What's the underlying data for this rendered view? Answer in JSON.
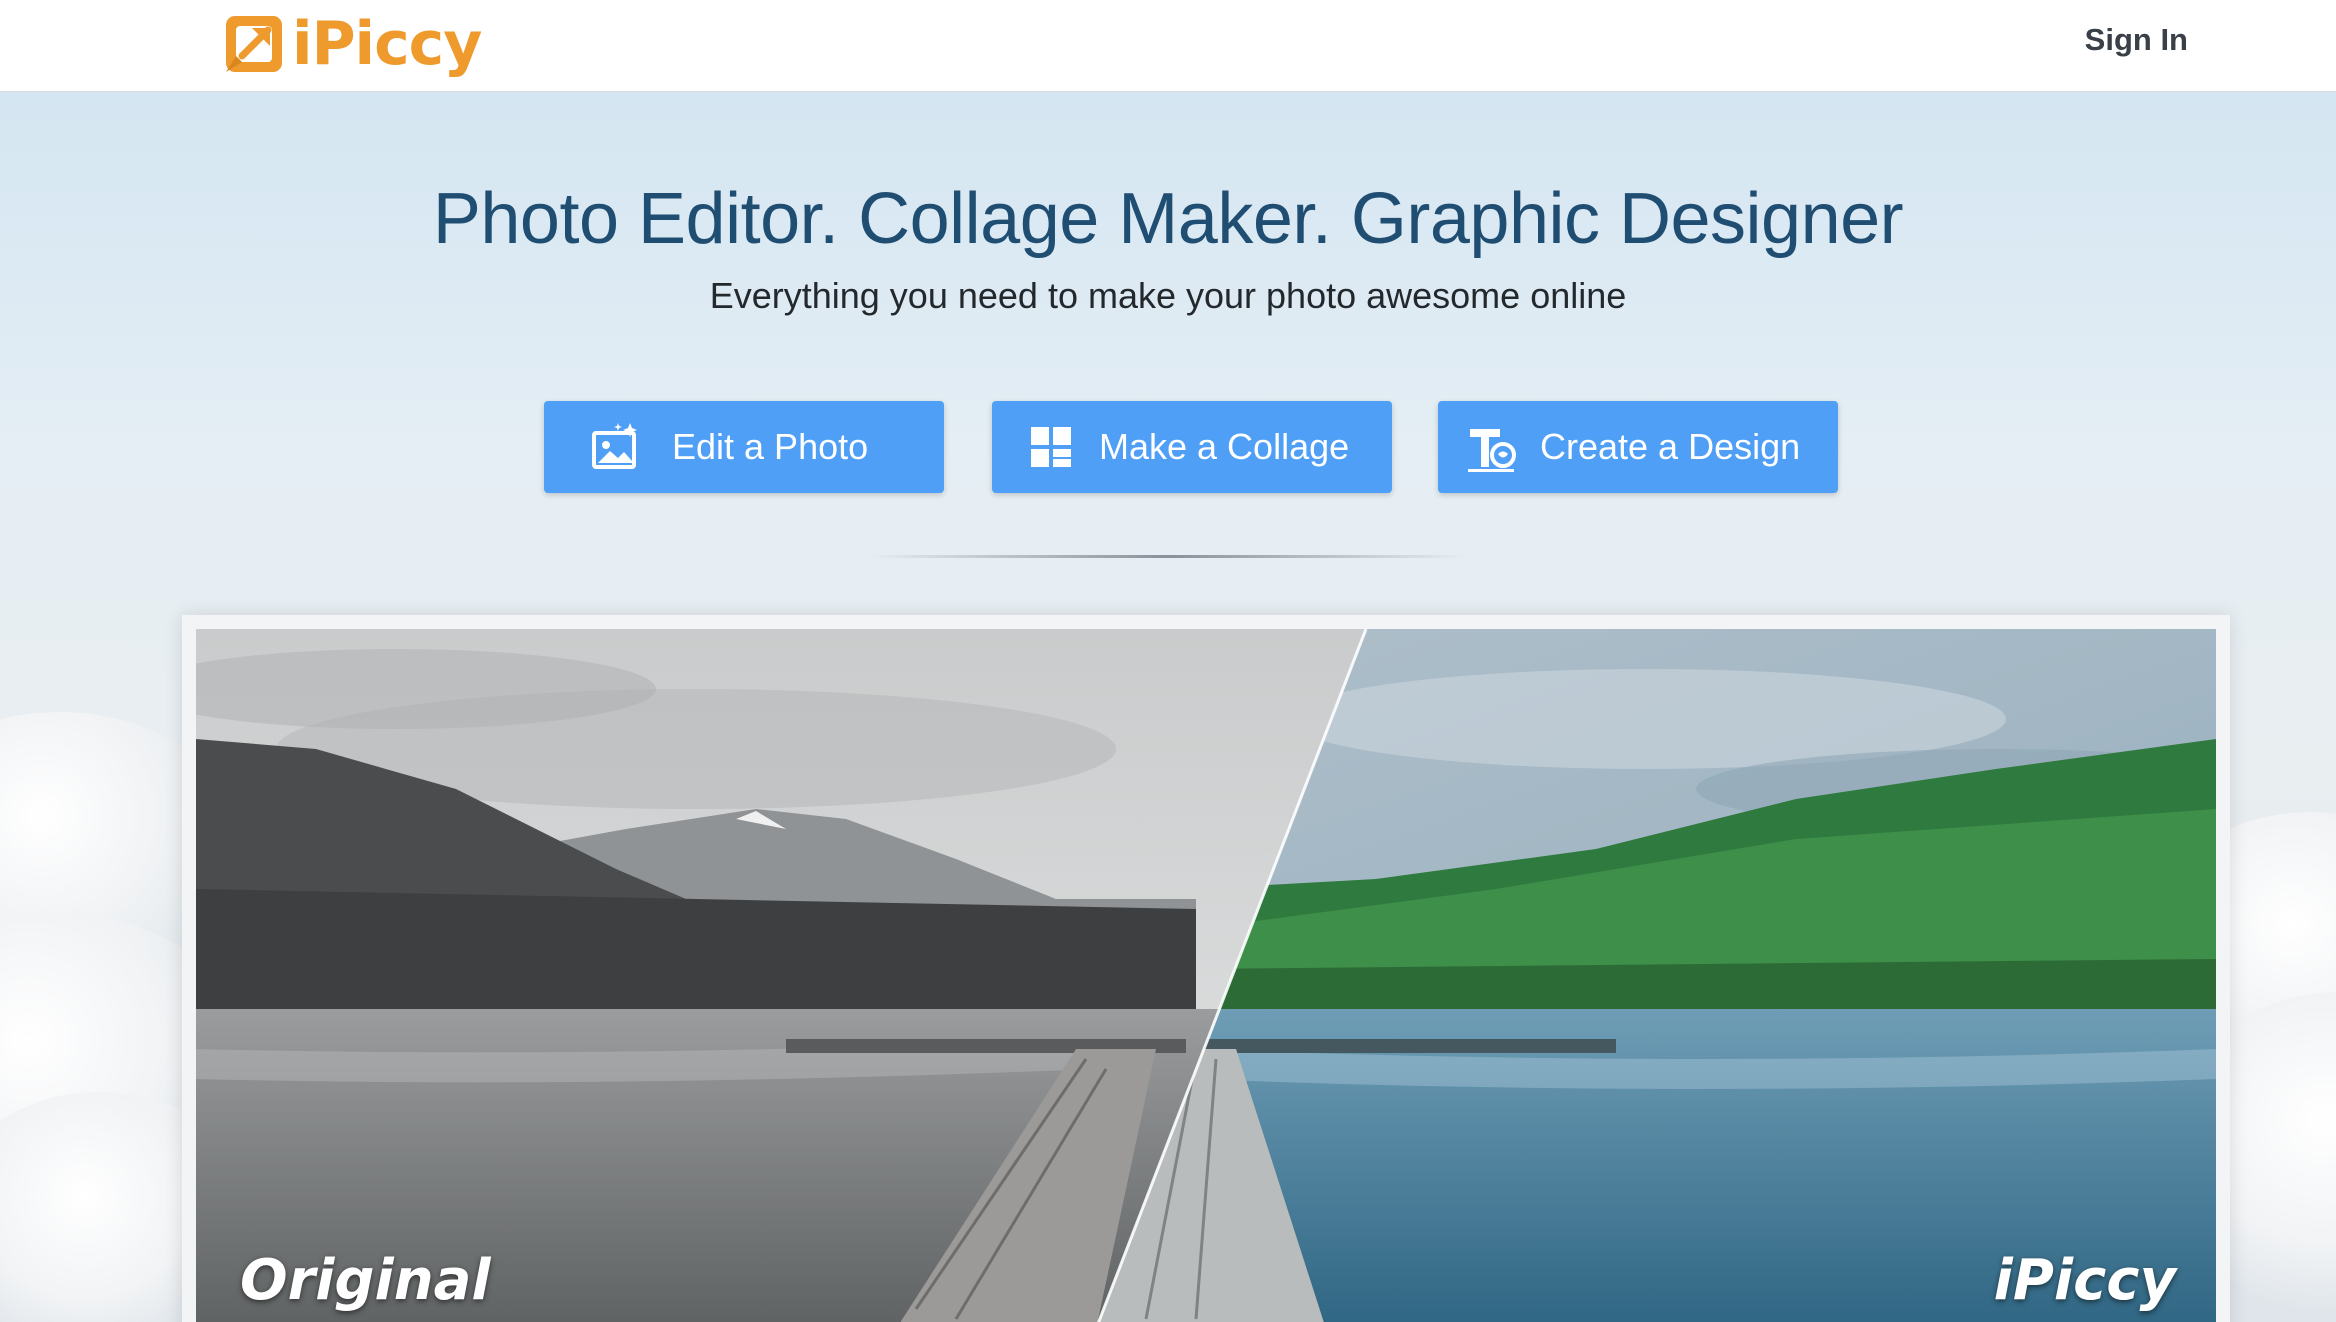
{
  "header": {
    "brand": "iPiccy",
    "logo_icon": "arrow-in-square-logo",
    "sign_in_label": "Sign In"
  },
  "hero": {
    "title": "Photo Editor. Collage Maker. Graphic Designer",
    "subtitle": "Everything you need to make your photo awesome online",
    "buttons": [
      {
        "label": "Edit a Photo",
        "icon": "photo-sparkle-icon"
      },
      {
        "label": "Make a Collage",
        "icon": "collage-grid-icon"
      },
      {
        "label": "Create a Design",
        "icon": "text-design-icon"
      }
    ]
  },
  "comparison": {
    "left_caption": "Original",
    "right_caption": "iPiccy"
  },
  "colors": {
    "brand_orange": "#ee9a2d",
    "button_blue": "#4e9ff5",
    "title_blue": "#1f4e72"
  }
}
